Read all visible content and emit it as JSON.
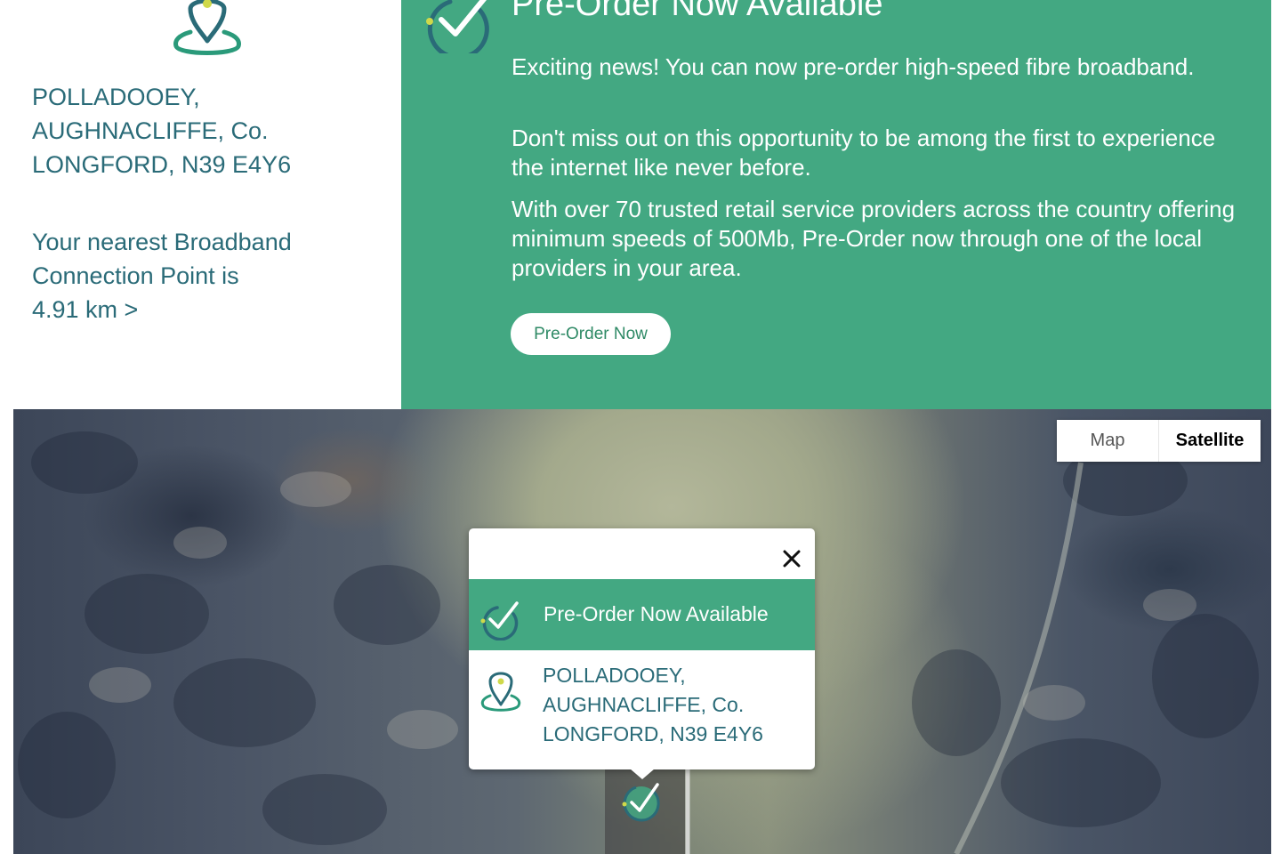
{
  "address": {
    "line1": "POLLADOOEY,",
    "line2": "AUGHNACLIFFE, Co.",
    "line3": "LONGFORD, N39 E4Y6"
  },
  "nearest": {
    "line1": "Your nearest Broadband",
    "line2": "Connection Point is",
    "line3": "4.91 km >"
  },
  "availability": {
    "title": "Pre-Order Now Available",
    "paragraph1": "Exciting news! You can now pre-order high-speed fibre broadband.",
    "paragraph2": "Don't miss out on this opportunity to be among the first to experience the internet like never before.",
    "paragraph3": "With over 70 trusted retail service providers across the country offering minimum speeds of 500Mb, Pre-Order now through one of the local providers in your area.",
    "button_label": "Pre-Order Now"
  },
  "map": {
    "toggle_map": "Map",
    "toggle_satellite": "Satellite",
    "selected_view": "Satellite",
    "popup": {
      "status": "Pre-Order Now Available",
      "address_line1": "POLLADOOEY,",
      "address_line2": "AUGHNACLIFFE, Co.",
      "address_line3": "LONGFORD, N39 E4Y6"
    }
  },
  "icons": {
    "location": "location-pin-icon",
    "check": "check-circle-icon",
    "close": "close-icon",
    "marker": "map-marker-icon"
  },
  "colors": {
    "brand_green": "#43a882",
    "text_teal": "#2a6b78",
    "accent_yellow": "#cfd94a"
  }
}
